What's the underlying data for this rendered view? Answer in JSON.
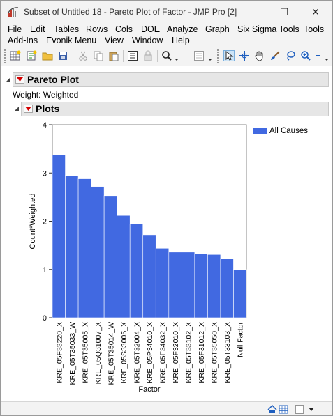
{
  "window": {
    "title": "Subset of Untitled 18 - Pareto Plot of Factor - JMP Pro [2]",
    "controls": {
      "minimize": "—",
      "maximize": "☐",
      "close": "✕"
    }
  },
  "menu": {
    "row1": [
      "File",
      "Edit",
      "Tables",
      "Rows",
      "Cols",
      "DOE",
      "Analyze",
      "Graph",
      "Six Sigma Tools",
      "Tools"
    ],
    "row2": [
      "Add-Ins",
      "Evonik Menu",
      "View",
      "Window",
      "Help"
    ]
  },
  "toolbar": {
    "icons": [
      "new-data-table-icon",
      "new-script-icon",
      "open-folder-icon",
      "save-icon",
      "cut-icon",
      "copy-icon",
      "paste-icon",
      "journal-icon",
      "lock-icon",
      "search-icon",
      "layout-icon",
      "arrow-tool-icon",
      "crosshair-tool-icon",
      "hand-tool-icon",
      "brush-tool-icon",
      "lasso-tool-icon",
      "magnifier-tool-icon"
    ]
  },
  "report": {
    "outline_title": "Pareto Plot",
    "weight_label": "Weight: Weighted",
    "plots_title": "Plots"
  },
  "chart_data": {
    "type": "bar",
    "categories": [
      "KRE_05F33220_X",
      "KRE_05T35033_W",
      "KRE_05T35005_X",
      "KRE_05Q31007_X",
      "KRE_05T35014_W",
      "KRE_05S33005_X",
      "KRE_05T32004_X",
      "KRE_05P34010_X",
      "KRE_05F34032_X",
      "KRE_05F32010_X",
      "KRE_05T33102_X",
      "KRE_05F31012_X",
      "KRE_05T35050_X",
      "KRE_05T33103_X",
      "Null Factor"
    ],
    "series": [
      {
        "name": "All Causes",
        "values": [
          3.37,
          2.95,
          2.88,
          2.72,
          2.53,
          2.12,
          1.94,
          1.72,
          1.44,
          1.36,
          1.36,
          1.32,
          1.31,
          1.22,
          1.0
        ]
      }
    ],
    "xlabel": "Factor",
    "ylabel": "Count*Weighted",
    "ylim": [
      0,
      4
    ],
    "yticks": [
      "0",
      "1",
      "2",
      "3",
      "4"
    ],
    "grid": false,
    "legend_position": "top-right",
    "bar_color": "#4169e1"
  },
  "status": {
    "icons": [
      "home-icon",
      "table-icon",
      "window-icon",
      "dropdown-arrow-icon"
    ]
  }
}
